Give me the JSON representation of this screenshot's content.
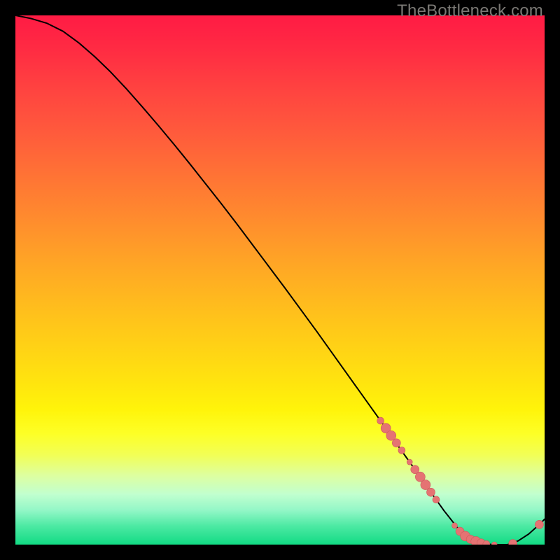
{
  "attribution": "TheBottleneck.com",
  "colors": {
    "bg_black": "#000000",
    "line": "#000000",
    "marker_fill": "#e57373",
    "marker_stroke": "#cc5b5b",
    "gradient_stops": [
      {
        "offset": 0.0,
        "color": "#ff1b44"
      },
      {
        "offset": 0.06,
        "color": "#ff2a43"
      },
      {
        "offset": 0.14,
        "color": "#ff4340"
      },
      {
        "offset": 0.22,
        "color": "#ff5a3c"
      },
      {
        "offset": 0.3,
        "color": "#ff7235"
      },
      {
        "offset": 0.38,
        "color": "#ff8a2e"
      },
      {
        "offset": 0.46,
        "color": "#ffa326"
      },
      {
        "offset": 0.54,
        "color": "#ffba1e"
      },
      {
        "offset": 0.62,
        "color": "#ffd016"
      },
      {
        "offset": 0.7,
        "color": "#ffe60e"
      },
      {
        "offset": 0.745,
        "color": "#fff40a"
      },
      {
        "offset": 0.79,
        "color": "#fdff26"
      },
      {
        "offset": 0.83,
        "color": "#f2ff55"
      },
      {
        "offset": 0.87,
        "color": "#ddffa1"
      },
      {
        "offset": 0.905,
        "color": "#c1ffcf"
      },
      {
        "offset": 0.935,
        "color": "#93f7c7"
      },
      {
        "offset": 0.965,
        "color": "#4ce9a3"
      },
      {
        "offset": 1.0,
        "color": "#12db84"
      }
    ]
  },
  "chart_data": {
    "type": "line",
    "title": "",
    "xlabel": "",
    "ylabel": "",
    "xlim": [
      0,
      100
    ],
    "ylim": [
      0,
      100
    ],
    "curve": {
      "x": [
        0,
        3,
        6,
        9,
        12,
        15,
        18,
        21,
        24,
        27,
        30,
        33,
        36,
        39,
        42,
        45,
        48,
        51,
        54,
        57,
        60,
        63,
        66,
        69,
        72,
        75,
        78,
        81,
        84,
        87,
        90,
        93,
        95,
        97,
        99,
        100
      ],
      "y": [
        100,
        99.4,
        98.5,
        97.0,
        94.8,
        92.2,
        89.3,
        86.1,
        82.7,
        79.2,
        75.6,
        71.9,
        68.1,
        64.3,
        60.4,
        56.4,
        52.4,
        48.4,
        44.3,
        40.2,
        36.0,
        31.8,
        27.6,
        23.4,
        19.1,
        14.9,
        10.6,
        6.4,
        2.6,
        0.6,
        0.0,
        0.0,
        0.7,
        2.0,
        3.8,
        4.8
      ]
    },
    "markers": [
      {
        "x": 69.0,
        "y": 23.4,
        "r": 5
      },
      {
        "x": 70.0,
        "y": 22.0,
        "r": 7
      },
      {
        "x": 71.0,
        "y": 20.6,
        "r": 7
      },
      {
        "x": 72.0,
        "y": 19.2,
        "r": 6
      },
      {
        "x": 73.0,
        "y": 17.8,
        "r": 5
      },
      {
        "x": 74.5,
        "y": 15.6,
        "r": 4
      },
      {
        "x": 75.5,
        "y": 14.2,
        "r": 6
      },
      {
        "x": 76.5,
        "y": 12.8,
        "r": 7
      },
      {
        "x": 77.5,
        "y": 11.3,
        "r": 7
      },
      {
        "x": 78.5,
        "y": 9.9,
        "r": 6
      },
      {
        "x": 79.5,
        "y": 8.5,
        "r": 5
      },
      {
        "x": 83.0,
        "y": 3.6,
        "r": 4
      },
      {
        "x": 84.0,
        "y": 2.5,
        "r": 6
      },
      {
        "x": 85.0,
        "y": 1.6,
        "r": 7
      },
      {
        "x": 86.0,
        "y": 1.0,
        "r": 6
      },
      {
        "x": 87.0,
        "y": 0.6,
        "r": 7
      },
      {
        "x": 88.0,
        "y": 0.3,
        "r": 6
      },
      {
        "x": 89.0,
        "y": 0.1,
        "r": 5
      },
      {
        "x": 90.5,
        "y": 0.0,
        "r": 4
      },
      {
        "x": 94.0,
        "y": 0.2,
        "r": 6
      },
      {
        "x": 99.0,
        "y": 3.8,
        "r": 6
      }
    ]
  }
}
